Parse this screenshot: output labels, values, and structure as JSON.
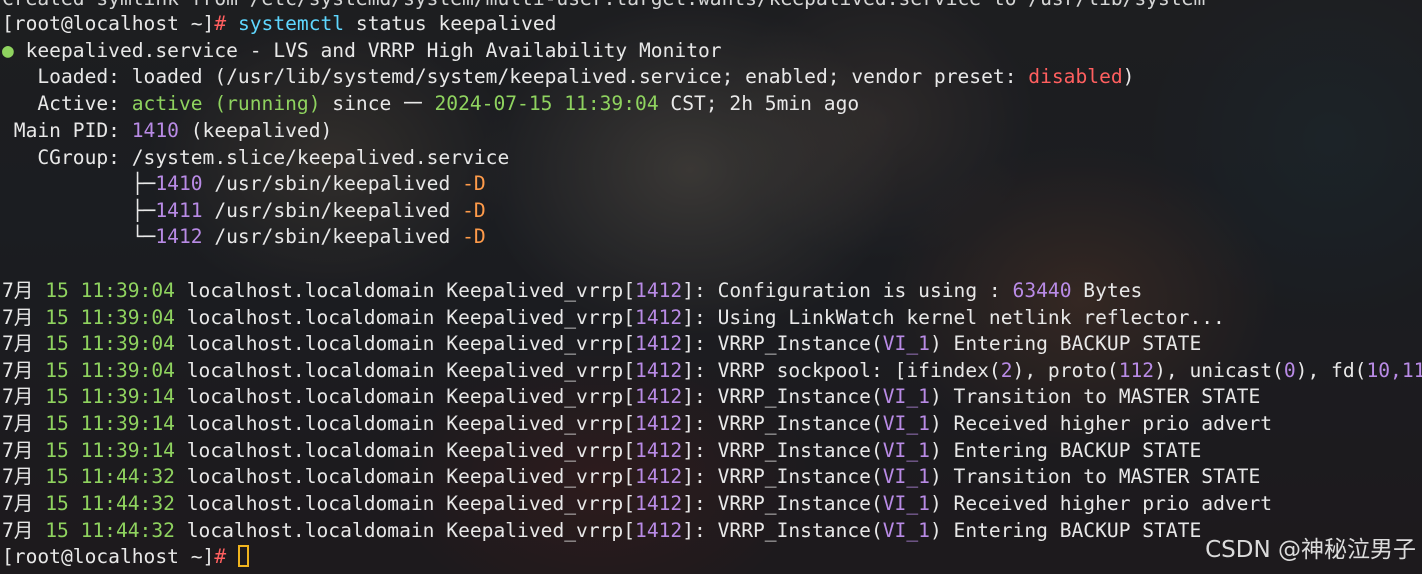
{
  "terminal": {
    "top_line": "Created symlink from /etc/systemd/system/multi-user.target.wants/keepalived.service to /usr/lib/system",
    "prompt": {
      "user_host": "[root@localhost ~]",
      "hash": "#",
      "command": "systemctl",
      "args": " status keepalived"
    },
    "status": {
      "bullet": "●",
      "service_line": "keepalived.service - LVS and VRRP High Availability Monitor",
      "loaded_label": "   Loaded",
      "loaded_value": ": loaded (/usr/lib/systemd/system/keepalived.service; enabled; vendor preset",
      "loaded_preset_sep": ": ",
      "loaded_preset": "disabled",
      "loaded_close": ")",
      "active_label": "   Active",
      "active_sep": ": ",
      "active_state": "active (running)",
      "since_word": " since 一 ",
      "since_time": "2024-07-15 11:39:04",
      "since_rest": " CST; 2h 5min ago",
      "pid_label": " Main PID",
      "pid_sep": ": ",
      "pid_value": "1410",
      "pid_name": " (keepalived)",
      "cgroup_label": "   CGroup",
      "cgroup_value": ": /system.slice/keepalived.service",
      "processes": [
        {
          "tree": "           ├─",
          "pid": "1410",
          "path": " /usr/sbin/keepalived ",
          "flag": "-D"
        },
        {
          "tree": "           ├─",
          "pid": "1411",
          "path": " /usr/sbin/keepalived ",
          "flag": "-D"
        },
        {
          "tree": "           └─",
          "pid": "1412",
          "path": " /usr/sbin/keepalived ",
          "flag": "-D"
        }
      ]
    },
    "logs": [
      {
        "month": "7月",
        "day": "15",
        "time": "11:39:04",
        "host": "localhost.localdomain",
        "proc": "Keepalived_vrrp",
        "pid": "1412",
        "msg": "Configuration is using : ",
        "num": "63440",
        "tail": " Bytes"
      },
      {
        "month": "7月",
        "day": "15",
        "time": "11:39:04",
        "host": "localhost.localdomain",
        "proc": "Keepalived_vrrp",
        "pid": "1412",
        "msg": "Using LinkWatch kernel netlink reflector..."
      },
      {
        "month": "7月",
        "day": "15",
        "time": "11:39:04",
        "host": "localhost.localdomain",
        "proc": "Keepalived_vrrp",
        "pid": "1412",
        "msg": "VRRP_Instance(",
        "inst": "VI_1",
        "tail": ") Entering BACKUP STATE"
      },
      {
        "month": "7月",
        "day": "15",
        "time": "11:39:04",
        "host": "localhost.localdomain",
        "proc": "Keepalived_vrrp",
        "pid": "1412",
        "msg": "VRRP sockpool: [ifindex(",
        "a1": "2",
        "m2": "), proto(",
        "a2": "112",
        "m3": "), unicast(",
        "a3": "0",
        "m4": "), fd(",
        "a4": "10,11",
        "m5": ")]"
      },
      {
        "month": "7月",
        "day": "15",
        "time": "11:39:14",
        "host": "localhost.localdomain",
        "proc": "Keepalived_vrrp",
        "pid": "1412",
        "msg": "VRRP_Instance(",
        "inst": "VI_1",
        "tail": ") Transition to MASTER STATE"
      },
      {
        "month": "7月",
        "day": "15",
        "time": "11:39:14",
        "host": "localhost.localdomain",
        "proc": "Keepalived_vrrp",
        "pid": "1412",
        "msg": "VRRP_Instance(",
        "inst": "VI_1",
        "tail": ") Received higher prio advert"
      },
      {
        "month": "7月",
        "day": "15",
        "time": "11:39:14",
        "host": "localhost.localdomain",
        "proc": "Keepalived_vrrp",
        "pid": "1412",
        "msg": "VRRP_Instance(",
        "inst": "VI_1",
        "tail": ") Entering BACKUP STATE"
      },
      {
        "month": "7月",
        "day": "15",
        "time": "11:44:32",
        "host": "localhost.localdomain",
        "proc": "Keepalived_vrrp",
        "pid": "1412",
        "msg": "VRRP_Instance(",
        "inst": "VI_1",
        "tail": ") Transition to MASTER STATE"
      },
      {
        "month": "7月",
        "day": "15",
        "time": "11:44:32",
        "host": "localhost.localdomain",
        "proc": "Keepalived_vrrp",
        "pid": "1412",
        "msg": "VRRP_Instance(",
        "inst": "VI_1",
        "tail": ") Received higher prio advert"
      },
      {
        "month": "7月",
        "day": "15",
        "time": "11:44:32",
        "host": "localhost.localdomain",
        "proc": "Keepalived_vrrp",
        "pid": "1412",
        "msg": "VRRP_Instance(",
        "inst": "VI_1",
        "tail": ") Entering BACKUP STATE"
      }
    ],
    "final_prompt": {
      "user_host": "[root@localhost ~]",
      "hash": "# "
    }
  },
  "watermark": "CSDN @神秘泣男子",
  "colors": {
    "green": "#8fd35f",
    "purple": "#b98be6",
    "red": "#ff5f5f",
    "orange": "#ff9b4a",
    "cyan": "#5fd7ff",
    "cursor": "#f0b41e"
  },
  "icons": {
    "cursor": "block-cursor-icon"
  }
}
